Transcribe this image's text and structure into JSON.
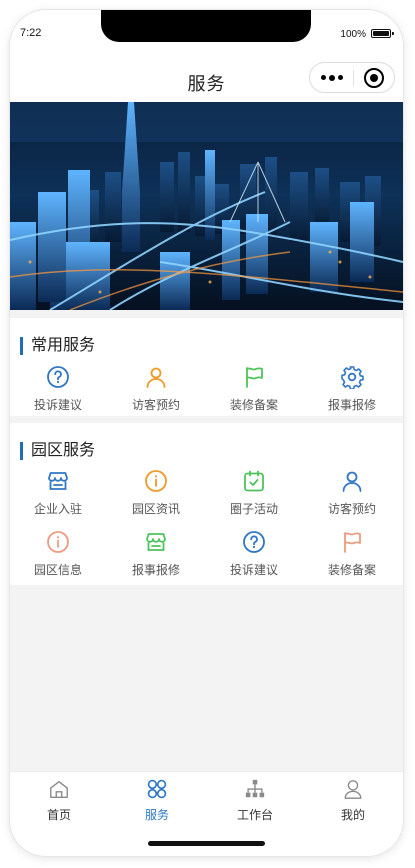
{
  "status_bar": {
    "time": "7:22",
    "battery": "100%"
  },
  "nav": {
    "title": "服务"
  },
  "common_services": {
    "title": "常用服务",
    "items": [
      {
        "label": "投诉建议",
        "icon": "question-circle-icon",
        "color": "#2f77c5"
      },
      {
        "label": "访客预约",
        "icon": "user-icon",
        "color": "#ef9a2a"
      },
      {
        "label": "装修备案",
        "icon": "flag-icon",
        "color": "#4fc35b"
      },
      {
        "label": "报事报修",
        "icon": "gear-icon",
        "color": "#2f77c5"
      }
    ]
  },
  "park_services": {
    "title": "园区服务",
    "items": [
      {
        "label": "企业入驻",
        "icon": "store-icon",
        "color": "#2f77c5"
      },
      {
        "label": "园区资讯",
        "icon": "info-circle-icon",
        "color": "#ef9a2a"
      },
      {
        "label": "圈子活动",
        "icon": "calendar-check-icon",
        "color": "#4fc35b"
      },
      {
        "label": "访客预约",
        "icon": "user-icon",
        "color": "#2f77c5"
      },
      {
        "label": "园区信息",
        "icon": "info-circle-icon",
        "color": "#ec9b82"
      },
      {
        "label": "报事报修",
        "icon": "store-icon",
        "color": "#4fc35b"
      },
      {
        "label": "投诉建议",
        "icon": "question-circle-icon",
        "color": "#2f77c5"
      },
      {
        "label": "装修备案",
        "icon": "flag-icon",
        "color": "#ec9b82"
      }
    ]
  },
  "tabbar": {
    "active_color": "#2f77c5",
    "items": [
      {
        "label": "首页",
        "icon": "home-icon"
      },
      {
        "label": "服务",
        "icon": "grid-icon",
        "active": true
      },
      {
        "label": "工作台",
        "icon": "org-chart-icon"
      },
      {
        "label": "我的",
        "icon": "profile-icon"
      }
    ]
  }
}
